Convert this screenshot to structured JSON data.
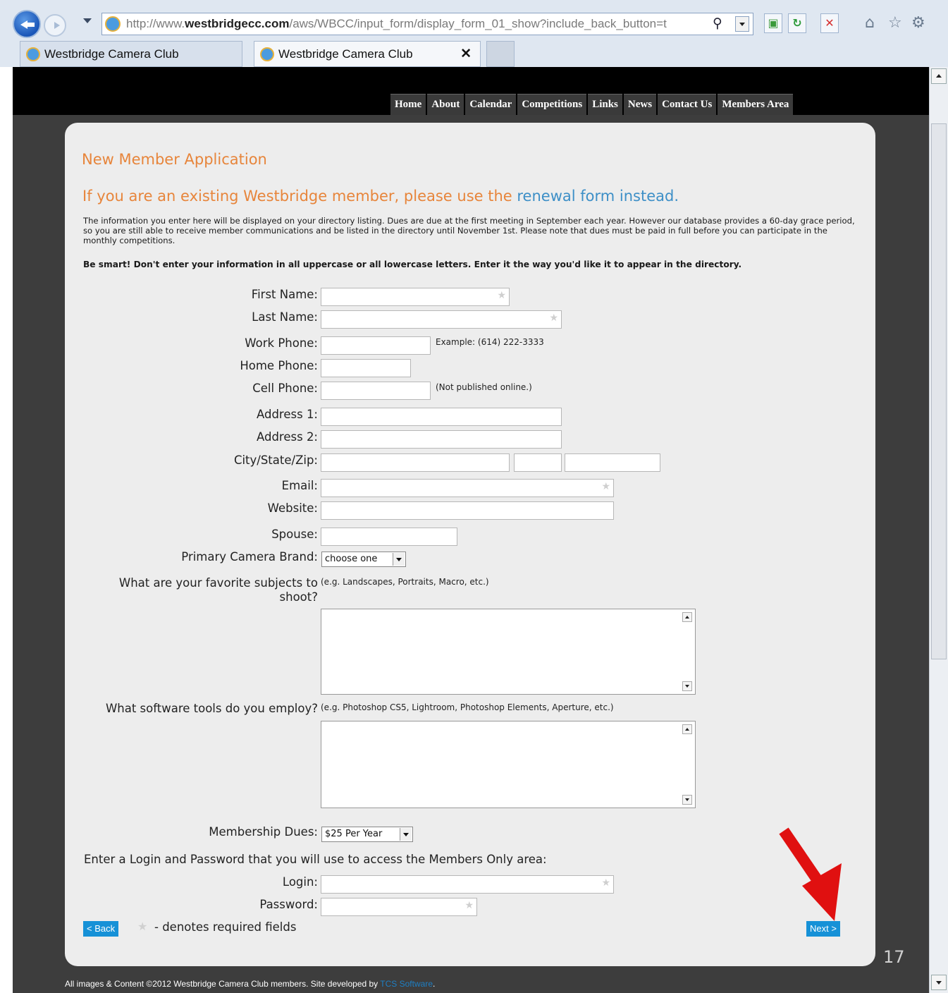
{
  "browser": {
    "url_prefix": "http://www.",
    "url_domain": "westbridgecc.com",
    "url_path": "/aws/WBCC/input_form/display_form_01_show?include_back_button=t",
    "tabs": [
      {
        "label": "Westbridge Camera Club"
      },
      {
        "label": "Westbridge Camera Club",
        "close": "✕"
      }
    ]
  },
  "nav": {
    "items": [
      "Home",
      "About",
      "Calendar",
      "Competitions",
      "Links",
      "News",
      "Contact Us",
      "Members Area"
    ]
  },
  "form": {
    "title": "New Member Application",
    "existing_notice": "If you are an existing Westbridge member, please use the ",
    "renewal_link": "renewal form instead.",
    "intro": "The information you enter here will be displayed on your directory listing. Dues are due at the first meeting in September each year. However our database provides a 60-day grace period, so you are still able to receive member communications and be listed in the directory until November 1st. Please note that dues must be paid in full before you can participate in the monthly competitions.",
    "advice": "Be smart! Don't enter your information in all uppercase or all lowercase letters. Enter it the way you'd like it to appear in the directory.",
    "labels": {
      "first_name": "First Name:",
      "last_name": "Last Name:",
      "work_phone": "Work Phone:",
      "home_phone": "Home Phone:",
      "cell_phone": "Cell Phone:",
      "address1": "Address 1:",
      "address2": "Address 2:",
      "city_state_zip": "City/State/Zip:",
      "email": "Email:",
      "website": "Website:",
      "spouse": "Spouse:",
      "camera_brand": "Primary Camera Brand:",
      "subjects_1": "What are your favorite subjects to",
      "subjects_2": "shoot?",
      "software": "What software tools do you employ?",
      "dues": "Membership Dues:",
      "login_intro": "Enter a Login and Password that you will use to access the Members Only area:",
      "login": "Login:",
      "password": "Password:"
    },
    "hints": {
      "work_phone": "Example: (614) 222-3333",
      "cell_phone": "(Not published online.)",
      "subjects": "(e.g. Landscapes, Portraits, Macro, etc.)",
      "software": "(e.g. Photoshop CS5, Lightroom, Photoshop Elements, Aperture, etc.)"
    },
    "values": {
      "camera_brand": "choose one",
      "dues": "$25 Per Year"
    },
    "required_star": "★",
    "required_note": "- denotes required fields",
    "back_label": "< Back",
    "next_label": "Next >"
  },
  "footer": {
    "text": "All images & Content ©2012 Westbridge Camera Club members.  Site developed by ",
    "link": "TCS Software",
    "end": "."
  },
  "slide_number": "17",
  "colors": {
    "accent_orange": "#e7853b",
    "link_blue": "#3d8fc7",
    "button_blue": "#1691d7",
    "arrow_red": "#e01010"
  }
}
